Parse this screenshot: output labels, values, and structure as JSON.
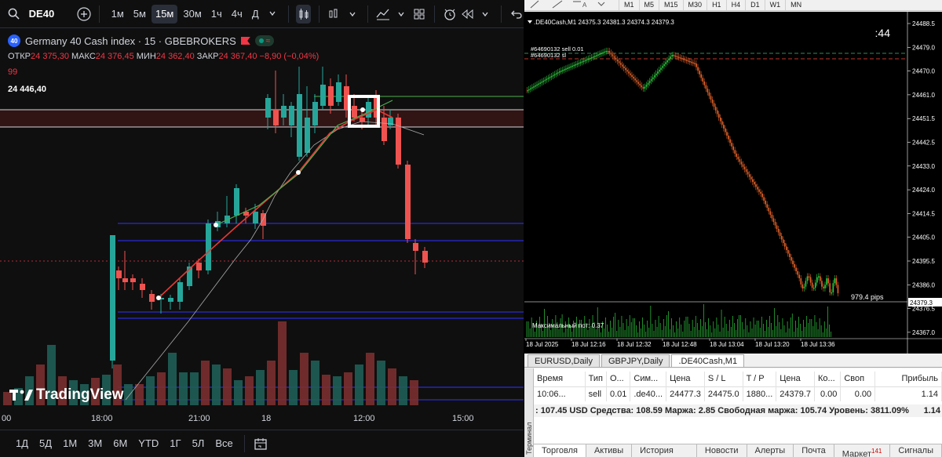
{
  "tv": {
    "symbol": "DE40",
    "timeframes": [
      "1м",
      "5м",
      "15м",
      "30м",
      "1ч",
      "4ч",
      "Д"
    ],
    "active_timeframe": "15м",
    "instrument_title": "Germany 40 Cash index · 15 · GBEBROKERS",
    "ohlc": {
      "open_label": "ОТКР",
      "open": "24 375,30",
      "high_label": "МАКС",
      "high": "24 376,45",
      "low_label": "МИН",
      "low": "24 362,40",
      "close_label": "ЗАКР",
      "close": "24 367,40",
      "change": "−8,90 (−0,04%)"
    },
    "indicator_value": "99",
    "price_label": "24 446,40",
    "logo_text": "TradingView",
    "time_axis": [
      "00",
      "18:00",
      "21:00",
      "18",
      "12:00",
      "15:00"
    ],
    "ranges": [
      "1Д",
      "5Д",
      "1М",
      "3М",
      "6М",
      "YTD",
      "1Г",
      "5Л",
      "Все"
    ],
    "badge": "40"
  },
  "mt": {
    "timeframes": [
      "M1",
      "M5",
      "M15",
      "M30",
      "H1",
      "H4",
      "D1",
      "W1",
      "MN"
    ],
    "chart_header": ".DE40Cash,M1  24375.3 24381.3 24374.3 24379.3",
    "countdown": ":44",
    "order_lines": [
      "#64690132 sell 0.01",
      "#64690132 sl"
    ],
    "pips_label": "979.4 pips",
    "indicator_text": "Максимальный пот: 0.37",
    "price_ticks": [
      "24488.5",
      "24479.0",
      "24470.0",
      "24461.0",
      "24451.5",
      "24442.5",
      "24433.0",
      "24424.0",
      "24414.5",
      "24405.0",
      "24395.5",
      "24386.0",
      "24376.5",
      "24367.0"
    ],
    "current_price": "24379.3",
    "time_ticks": [
      "18 Jul 2025",
      "18 Jul 12:16",
      "18 Jul 12:32",
      "18 Jul 12:48",
      "18 Jul 13:04",
      "18 Jul 13:20",
      "18 Jul 13:36"
    ],
    "chart_tabs": [
      "EURUSD,Daily",
      "GBPJPY,Daily",
      ".DE40Cash,M1"
    ],
    "active_chart_tab": ".DE40Cash,M1",
    "table_headers": [
      "Время",
      "Тип",
      "О...",
      "Сим...",
      "Цена",
      "S / L",
      "T / P",
      "Цена",
      "Ко...",
      "Своп",
      "Прибыль"
    ],
    "table_row": [
      "10:06...",
      "sell",
      "0.01",
      ".de40...",
      "24477.3",
      "24475.0",
      "1880...",
      "24379.7",
      "0.00",
      "0.00",
      "1.14"
    ],
    "balance_line": ": 107.45 USD  Средства: 108.59  Маржа: 2.85  Свободная маржа: 105.74  Уровень: 3811.09%",
    "balance_profit": "1.14",
    "terminal_label": "Терминал",
    "bottom_tabs": [
      "Торговля",
      "Активы",
      "История Счета",
      "Новости",
      "Алерты",
      "Почта",
      "Маркет",
      "Сигналы"
    ],
    "market_badge": "141"
  }
}
